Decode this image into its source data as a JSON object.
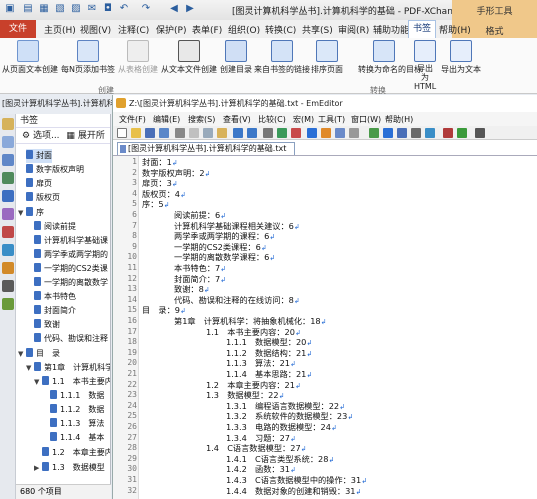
{
  "window": {
    "title": "[图灵计算机科学丛书].计算机科学的基础 - PDF-XChange Editor"
  },
  "context_tab": {
    "group": "手形工具",
    "tab": "格式"
  },
  "menu": {
    "file": "文件",
    "tabs": [
      "主页(H)",
      "视图(V)",
      "注释(C)",
      "保护(P)",
      "表单(F)",
      "组织(O)",
      "转换(C)",
      "共享(S)",
      "审阅(R)",
      "辅助功能",
      "书签",
      "帮助(H)"
    ]
  },
  "ribbon": {
    "buttons": [
      "从页面文本创建",
      "每N页添加书签",
      "从表格创建",
      "从文本文件创建",
      "创建目录",
      "来自书签的链接",
      "排序页面",
      "转换为命名的目标",
      "导出为HTML",
      "导出为文本"
    ],
    "groups": [
      "创建",
      "转换"
    ]
  },
  "doc_tab": "[图灵计算机科学丛书].计算机科",
  "bookmarks": {
    "header": "书签",
    "options": "选项...",
    "expand": "展开所",
    "items": [
      "封面",
      "数字版权声明",
      "扉页",
      "版权页",
      "序",
      "阅读前提",
      "计算机科学基础课",
      "两学季或两学期的",
      "一学期的CS2类课",
      "一学期的离散数学",
      "本书特色",
      "封面简介",
      "致谢",
      "代码、勘误和注释",
      "目　录",
      "第1章　计算机科学",
      "1.1　本书主要内",
      "1.1.1　数据",
      "1.1.2　数据",
      "1.1.3　算法",
      "1.1.4　基本",
      "1.2　本章主要内",
      "1.3　数据模型"
    ],
    "count": "680 个项目"
  },
  "emeditor": {
    "title": "Z:\\[图灵计算机科学丛书].计算机科学的基础.txt - EmEditor",
    "menu": [
      "文件(F)",
      "编辑(E)",
      "搜索(S)",
      "查看(V)",
      "比较(C)",
      "宏(M)",
      "工具(T)",
      "窗口(W)",
      "帮助(H)"
    ],
    "doc_tab": "[图灵计算机科学丛书].计算机科学的基础.txt",
    "lines": [
      "封面：1",
      "数字版权声明：2",
      "扉页：3",
      "版权页：4",
      "序：5",
      "阅读前提：6",
      "计算机科学基础课程相关建议：6",
      "两学季或两学期的课程：6",
      "一学期的CS2类课程：6",
      "一学期的离散数学课程：6",
      "本书特色：7",
      "封面简介：7",
      "致谢：8",
      "代码、勘误和注释的在线访问：8",
      "目　录：9",
      "第1章　计算机科学：将抽象机械化：18",
      "1.1　本书主要内容：20",
      "1.1.1　数据模型：20",
      "1.1.2　数据结构：21",
      "1.1.3　算法：21",
      "1.1.4　基本思路：21",
      "1.2　本章主要内容：21",
      "1.3　数据模型：22",
      "1.3.1　编程语言数据模型：22",
      "1.3.2　系统软件的数据模型：23",
      "1.3.3　电路的数据模型：24",
      "1.3.4　习题：27",
      "1.4　C语言数据模型：27",
      "1.4.1　C语言类型系统：28",
      "1.4.2　函数：31",
      "1.4.3　C语言数据模型中的操作：31",
      "1.4.4　数据对象的创建和销毁：31"
    ]
  },
  "colors": {
    "file_btn": "#c8402b",
    "context_tab": "#f0c88a",
    "accent": "#2b5e9e",
    "cr_mark": "#2a6fd6"
  }
}
